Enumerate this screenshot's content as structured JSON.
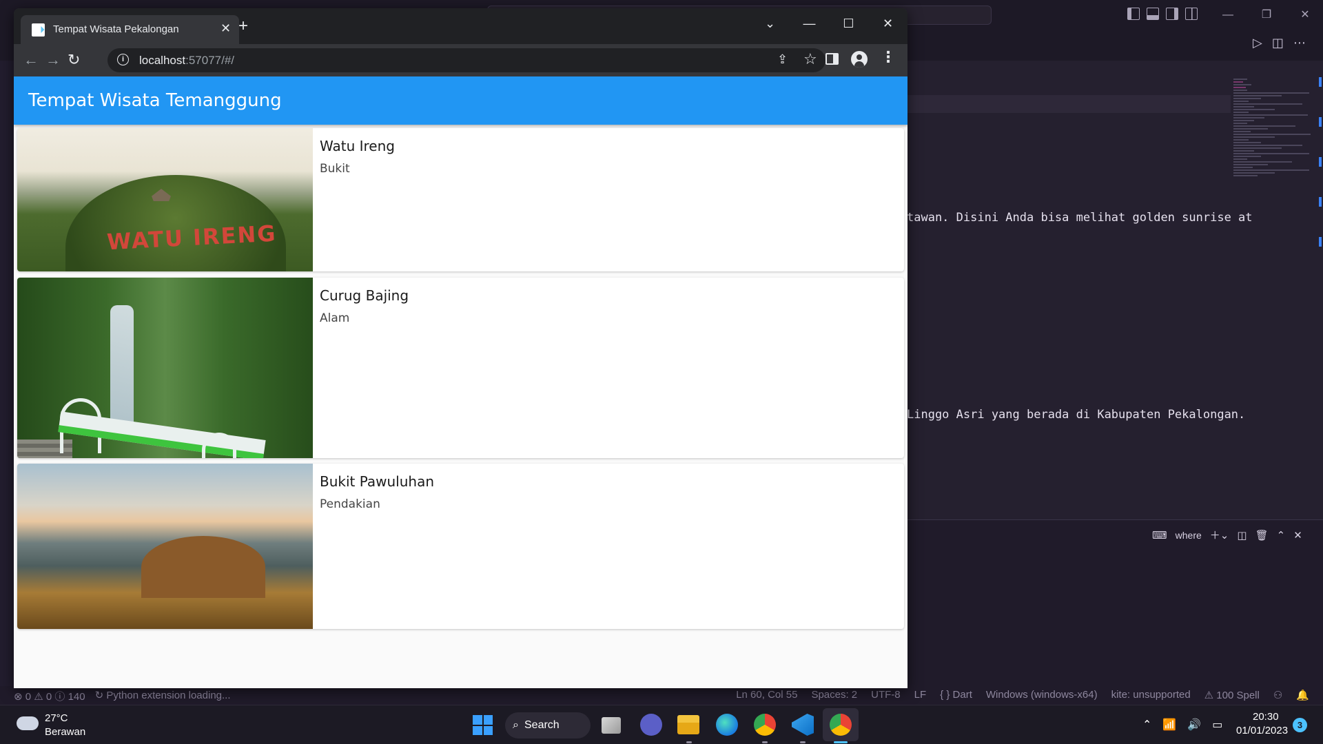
{
  "browser": {
    "tab_title": "Tempat Wisata Pekalongan",
    "url_host": "localhost",
    "url_rest": ":57077/#/"
  },
  "app": {
    "title": "Tempat Wisata Temanggung",
    "accent_color": "#2196f3",
    "places": [
      {
        "name": "Watu Ireng",
        "category": "Bukit",
        "image_text": "WATU IRENG"
      },
      {
        "name": "Curug Bajing",
        "category": "Alam"
      },
      {
        "name": "Bukit Pawuluhan",
        "category": "Pendakian"
      }
    ]
  },
  "editor": {
    "line1": "tawan. Disini Anda bisa melihat golden sunrise at",
    "line2": "Linggo Asri yang berada di Kabupaten Pekalongan.",
    "terminal_label": "where"
  },
  "statusbar": {
    "errors": "0",
    "warnings": "0",
    "infos": "140",
    "python_status": "Python extension loading...",
    "cursor": "Ln 60, Col 55",
    "spaces": "Spaces: 2",
    "encoding": "UTF-8",
    "eol": "LF",
    "language": "Dart",
    "platform": "Windows (windows-x64)",
    "kite": "kite: unsupported",
    "spell": "100 Spell"
  },
  "taskbar": {
    "temperature": "27°C",
    "weather": "Berawan",
    "search_label": "Search",
    "time": "20:30",
    "date": "01/01/2023",
    "notification_count": "3"
  }
}
